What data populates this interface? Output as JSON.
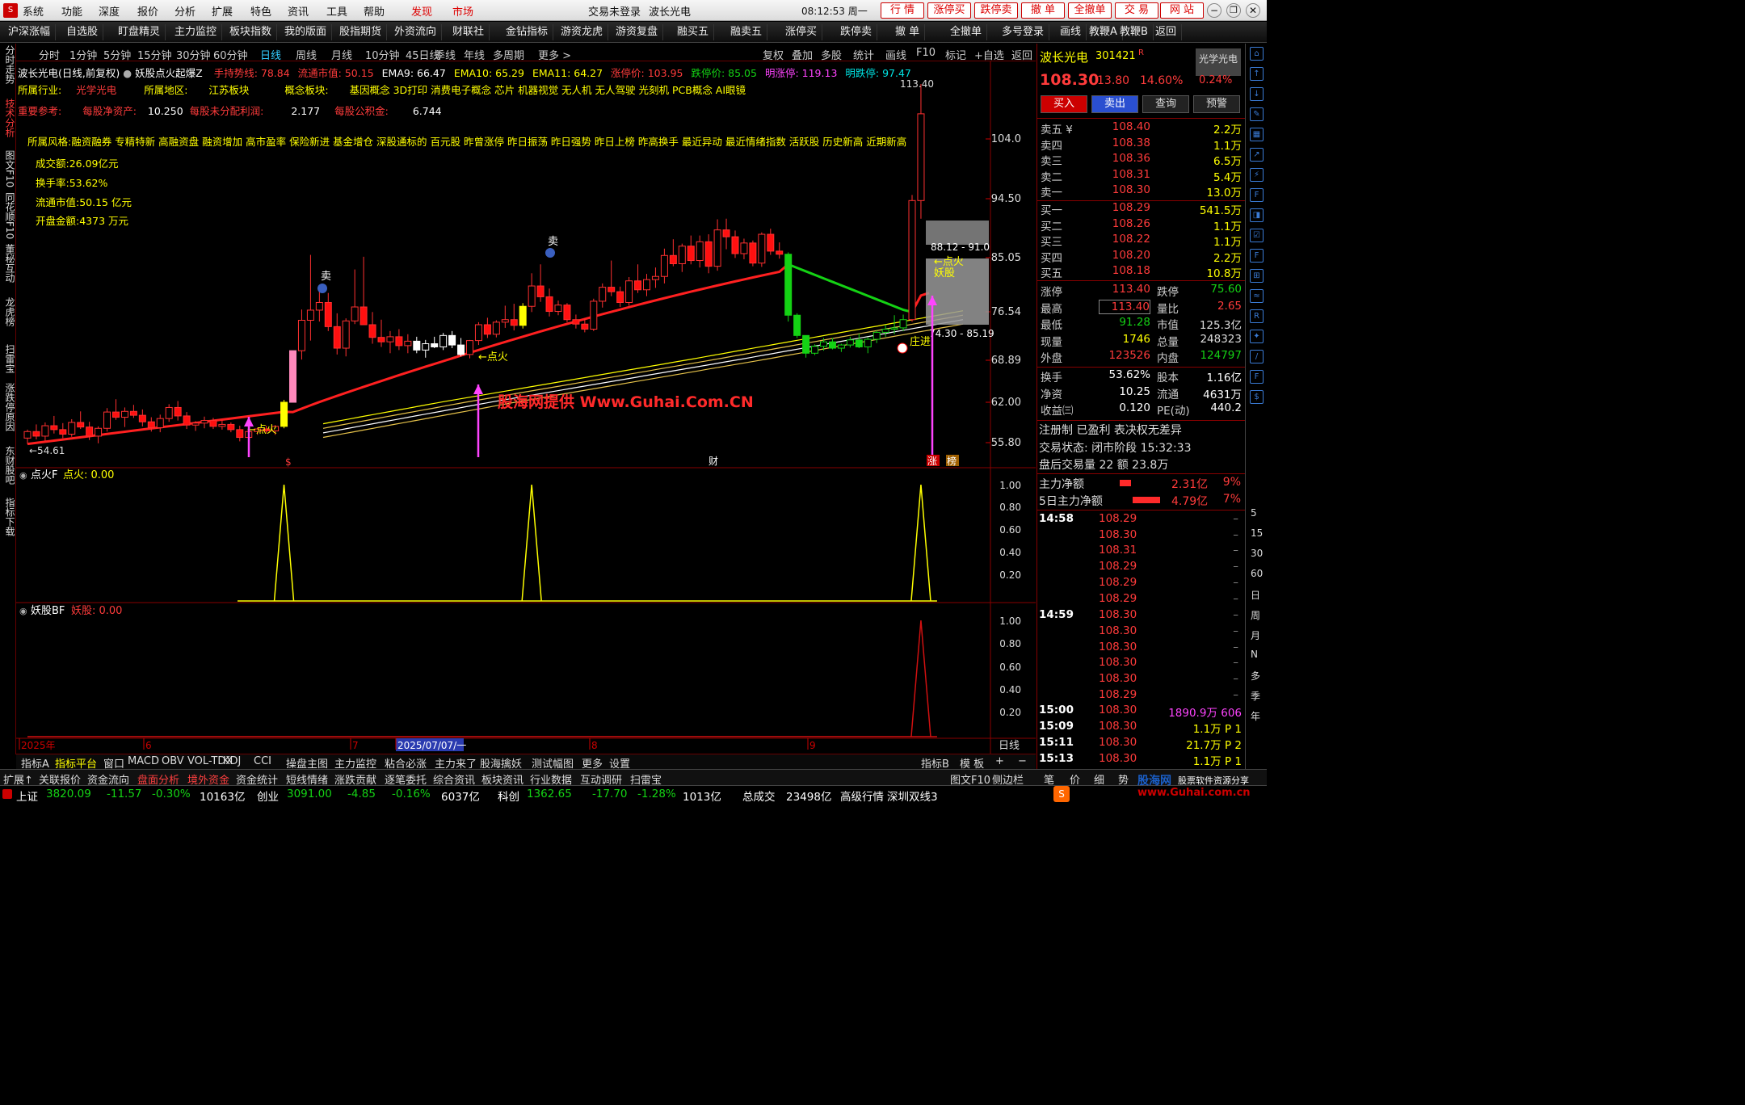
{
  "menu": {
    "items": [
      "系统",
      "功能",
      "深度",
      "报价",
      "分析",
      "扩展",
      "特色",
      "资讯",
      "工具",
      "帮助"
    ],
    "faxian": "发现",
    "shichang": "市场",
    "login_status": "交易未登录",
    "stock_name": "波长光电",
    "clock": "08:12:53 周一",
    "red_buttons": [
      "行 情",
      "涨停买",
      "跌停卖",
      "撤 单",
      "全撤单",
      "交 易",
      "网 站"
    ]
  },
  "toolbar": [
    "沪深涨幅",
    "自选股",
    "盯盘精灵",
    "主力监控",
    "板块指数",
    "我的版面",
    "股指期货",
    "外资流向",
    "财联社",
    "金钻指标",
    "游资龙虎",
    "游资复盘",
    "融买五",
    "融卖五",
    "涨停买",
    "跌停卖",
    "撤 单",
    "全撤单",
    "多号登录",
    "画线",
    "教鞭A",
    "教鞭B",
    "返回"
  ],
  "left_tabs": [
    "分时走势",
    "技术分析",
    "图文F10",
    "同花顺F10",
    "董秘互动",
    "龙虎榜",
    "扫雷宝",
    "涨跌停原因",
    "东财股吧",
    "指标下载"
  ],
  "periods": [
    "分时",
    "1分钟",
    "5分钟",
    "15分钟",
    "30分钟",
    "60分钟",
    "日线",
    "周线",
    "月线",
    "10分钟",
    "45日线",
    "季线",
    "年线",
    "多周期",
    "更多 >"
  ],
  "period_right": [
    "复权",
    "叠加",
    "多股",
    "统计",
    "画线",
    "F10",
    "标记",
    "+自选",
    "返回"
  ],
  "chart_header": {
    "title": "波长光电(日线,前复权)",
    "indicator": "妖股点火起爆Z",
    "items": [
      {
        "t": "手持势线: 78.84",
        "c": "#ff3b3b"
      },
      {
        "t": "流通市值: 50.15",
        "c": "#ff3b3b"
      },
      {
        "t": "EMA9: 66.47",
        "c": "#ffffff"
      },
      {
        "t": "EMA10: 65.29",
        "c": "#ffff00"
      },
      {
        "t": "EMA11: 64.27",
        "c": "#ffff00"
      },
      {
        "t": "涨停价: 103.95",
        "c": "#ff3b3b"
      },
      {
        "t": "跌停价: 85.05",
        "c": "#14d214"
      },
      {
        "t": "明涨停: 119.13",
        "c": "#ff44ff"
      },
      {
        "t": "明跌停: 97.47",
        "c": "#00e5e5"
      }
    ],
    "hy_label": "所属行业:",
    "hy_value": "光学光电",
    "dq_label": "所属地区:",
    "dq_value": "江苏板块",
    "gn_label": "概念板块:",
    "gn_value": "基因概念 3D打印 消费电子概念 芯片 机器视觉 无人机 无人驾驶 光刻机 PCB概念 AI眼镜",
    "zy_label": "重要参考:",
    "jzc_label": "每股净资产:",
    "jzc_value": "10.250",
    "wfp_label": "每股未分配利润:",
    "wfp_value": "2.177",
    "gjj_label": "每股公积金:",
    "gjj_value": "6.744",
    "style_line": "所属风格:融资融券 专精特新 高融资盘 融资增加 高市盈率 保险新进 基金增仓 深股通标的 百元股 昨曾涨停 昨日振荡 昨日强势 昨日上榜 昨高换手 最近异动 最近情绪指数 活跃股 历史新高 近期新高",
    "cje": "成交额:26.09亿元",
    "hsl": "换手率:53.62%",
    "ltsz": "流通市值:50.15 亿元",
    "kpje": "开盘金额:4373 万元",
    "watermark": "股海网提供 Www.Guhai.Com.CN",
    "high_label": "113.40",
    "low_label": "←54.61",
    "box_label1": "88.12 - 91.0",
    "box_label2": "74.30 - 85.19",
    "dianhuo": "←点火",
    "yaogu": "妖股",
    "zhuangjin": "庄进",
    "mai": "卖",
    "cai": "财",
    "zhang": "涨",
    "bang": "榜"
  },
  "chart_data": {
    "type": "candlestick",
    "y_ticks": [
      "104.0",
      "94.50",
      "85.05",
      "76.54",
      "68.89",
      "62.00",
      "55.80"
    ],
    "x_labels": [
      "2025年",
      "6",
      "7",
      "2025/07/07/一",
      "8",
      "9"
    ],
    "candles": [
      [
        56.5,
        57.8,
        55.6,
        57.5
      ],
      [
        57.5,
        58.6,
        56.3,
        56.8
      ],
      [
        56.8,
        58.9,
        56.1,
        58.4
      ],
      [
        58.4,
        59.9,
        57.2,
        57.8
      ],
      [
        57.8,
        58.8,
        56.5,
        57.1
      ],
      [
        57.1,
        59.4,
        56.7,
        58.9
      ],
      [
        58.9,
        60.6,
        57.9,
        58.2
      ],
      [
        58.2,
        59.0,
        56.2,
        56.8
      ],
      [
        56.8,
        58.3,
        55.7,
        58.0
      ],
      [
        58.0,
        61.1,
        57.5,
        60.5
      ],
      [
        60.5,
        62.5,
        59.3,
        59.7
      ],
      [
        59.7,
        61.2,
        58.2,
        60.6
      ],
      [
        60.6,
        61.6,
        59.6,
        60.0
      ],
      [
        60.0,
        60.9,
        58.3,
        59.0
      ],
      [
        59.0,
        59.7,
        57.5,
        58.1
      ],
      [
        58.1,
        60.1,
        57.4,
        59.5
      ],
      [
        59.5,
        61.7,
        59.0,
        61.2
      ],
      [
        61.2,
        62.2,
        59.2,
        59.9
      ],
      [
        59.9,
        60.5,
        57.9,
        58.5
      ],
      [
        58.5,
        59.1,
        57.6,
        58.8
      ],
      [
        58.8,
        59.8,
        58.0,
        59.2
      ],
      [
        59.2,
        59.6,
        57.9,
        58.3
      ],
      [
        58.3,
        59.2,
        57.8,
        58.6
      ],
      [
        58.6,
        58.9,
        57.4,
        57.8
      ],
      [
        57.8,
        58.4,
        56.0,
        56.6
      ],
      [
        56.6,
        57.9,
        56.0,
        57.5
      ],
      [
        57.5,
        58.1,
        57.0,
        57.9
      ],
      [
        57.9,
        58.4,
        57.2,
        57.6
      ],
      [
        57.6,
        58.5,
        57.0,
        58.3
      ],
      [
        58.3,
        62.4,
        58.0,
        62.0
      ],
      [
        62.0,
        70.4,
        62.0,
        70.4
      ],
      [
        70.4,
        76.9,
        69.0,
        75.2
      ],
      [
        75.2,
        85.5,
        72.0,
        76.8
      ],
      [
        76.8,
        79.8,
        75.0,
        78.0
      ],
      [
        78.0,
        79.5,
        73.5,
        74.2
      ],
      [
        74.2,
        76.3,
        69.8,
        70.8
      ],
      [
        70.8,
        75.5,
        69.5,
        75.1
      ],
      [
        75.1,
        83.2,
        74.6,
        77.3
      ],
      [
        77.3,
        85.2,
        75.8,
        74.5
      ],
      [
        74.5,
        76.5,
        71.5,
        72.5
      ],
      [
        72.5,
        75.3,
        71.0,
        71.8
      ],
      [
        71.8,
        73.5,
        70.0,
        72.6
      ],
      [
        72.6,
        73.8,
        70.5,
        71.2
      ],
      [
        71.2,
        73.0,
        70.0,
        71.9
      ],
      [
        71.9,
        72.6,
        70.0,
        70.5
      ],
      [
        70.5,
        72.1,
        69.3,
        71.5
      ],
      [
        71.5,
        72.6,
        70.8,
        71.0
      ],
      [
        71.0,
        73.2,
        70.5,
        72.8
      ],
      [
        72.8,
        73.5,
        70.8,
        71.3
      ],
      [
        71.3,
        72.4,
        69.5,
        69.8
      ],
      [
        69.8,
        72.1,
        69.2,
        72.0
      ],
      [
        72.0,
        74.9,
        71.3,
        74.5
      ],
      [
        74.5,
        75.6,
        72.4,
        73.0
      ],
      [
        73.0,
        75.2,
        72.5,
        74.9
      ],
      [
        74.9,
        77.5,
        74.0,
        75.3
      ],
      [
        75.3,
        77.8,
        73.6,
        74.4
      ],
      [
        74.4,
        77.9,
        73.9,
        77.4
      ],
      [
        77.4,
        82.6,
        76.5,
        80.6
      ],
      [
        80.6,
        84.0,
        78.1,
        78.9
      ],
      [
        78.9,
        80.2,
        75.8,
        76.6
      ],
      [
        76.6,
        78.3,
        76.0,
        77.6
      ],
      [
        77.6,
        77.9,
        74.9,
        75.3
      ],
      [
        75.3,
        76.1,
        73.9,
        74.6
      ],
      [
        74.6,
        75.5,
        73.3,
        73.8
      ],
      [
        73.8,
        78.6,
        73.5,
        78.2
      ],
      [
        78.2,
        81.0,
        77.2,
        80.4
      ],
      [
        80.4,
        84.6,
        79.0,
        79.7
      ],
      [
        79.7,
        80.5,
        77.3,
        78.0
      ],
      [
        78.0,
        82.0,
        77.5,
        81.4
      ],
      [
        81.4,
        84.0,
        79.5,
        80.0
      ],
      [
        80.0,
        82.5,
        79.0,
        81.6
      ],
      [
        81.6,
        83.5,
        80.3,
        82.1
      ],
      [
        82.1,
        86.5,
        81.0,
        85.4
      ],
      [
        85.4,
        88.0,
        83.7,
        84.1
      ],
      [
        84.1,
        87.3,
        82.8,
        86.9
      ],
      [
        86.9,
        88.6,
        84.0,
        84.6
      ],
      [
        84.6,
        88.6,
        83.5,
        87.6
      ],
      [
        87.6,
        88.8,
        82.6,
        83.7
      ],
      [
        83.7,
        91.2,
        83.0,
        89.5
      ],
      [
        89.5,
        91.3,
        86.4,
        88.4
      ],
      [
        88.4,
        89.4,
        85.0,
        85.7
      ],
      [
        85.7,
        88.1,
        84.8,
        87.4
      ],
      [
        87.4,
        87.8,
        83.7,
        84.2
      ],
      [
        84.2,
        89.1,
        83.6,
        88.8
      ],
      [
        88.8,
        89.7,
        85.5,
        86.1
      ],
      [
        86.1,
        87.5,
        84.9,
        85.6
      ],
      [
        85.6,
        85.9,
        75.0,
        76.0
      ],
      [
        76.0,
        76.3,
        72.4,
        72.8
      ],
      [
        72.8,
        72.6,
        69.3,
        70.0
      ],
      [
        70.0,
        71.4,
        69.7,
        71.1
      ],
      [
        71.1,
        72.4,
        70.4,
        71.8
      ],
      [
        71.8,
        72.4,
        70.6,
        70.8
      ],
      [
        70.8,
        71.5,
        70.2,
        71.3
      ],
      [
        71.3,
        72.6,
        70.9,
        72.1
      ],
      [
        72.1,
        73.1,
        70.8,
        71.0
      ],
      [
        71.0,
        72.5,
        70.0,
        72.2
      ],
      [
        72.2,
        73.6,
        71.6,
        73.3
      ],
      [
        73.3,
        74.5,
        72.6,
        73.8
      ],
      [
        73.8,
        76.0,
        73.0,
        74.0
      ],
      [
        74.0,
        76.1,
        73.5,
        75.3
      ],
      [
        75.3,
        95.1,
        75.0,
        94.2
      ],
      [
        94.2,
        113.4,
        91.3,
        108.3
      ]
    ],
    "signal_positions": [
      29,
      57,
      101
    ],
    "yaogu_positions": [
      101
    ]
  },
  "panel2": {
    "name": "点火F",
    "label": "点火: 0.00",
    "ticks": [
      "1.00",
      "0.80",
      "0.60",
      "0.40",
      "0.20"
    ]
  },
  "panel3": {
    "name": "妖股BF",
    "label": "妖股: 0.00",
    "ticks": [
      "1.00",
      "0.80",
      "0.60",
      "0.40",
      "0.20"
    ]
  },
  "right": {
    "name": "波长光电",
    "code": "301421",
    "tag": "R",
    "sector": "光学光电",
    "price": "108.30",
    "chg": "13.80",
    "pct": "14.60%",
    "pct2": "0.24%",
    "buttons": [
      "买入",
      "卖出",
      "查询",
      "预警"
    ],
    "sells": [
      [
        "卖五 ¥",
        "108.40",
        "2.2万"
      ],
      [
        "卖四",
        "108.38",
        "1.1万"
      ],
      [
        "卖三",
        "108.36",
        "6.5万"
      ],
      [
        "卖二",
        "108.31",
        "5.4万"
      ],
      [
        "卖一",
        "108.30",
        "13.0万"
      ]
    ],
    "buys": [
      [
        "买一",
        "108.29",
        "541.5万"
      ],
      [
        "买二",
        "108.26",
        "1.1万"
      ],
      [
        "买三",
        "108.22",
        "1.1万"
      ],
      [
        "买四",
        "108.20",
        "2.2万"
      ],
      [
        "买五",
        "108.18",
        "10.8万"
      ]
    ],
    "stats": [
      [
        "涨停",
        "113.40",
        "跌停",
        "75.60"
      ],
      [
        "最高",
        "113.40",
        "量比",
        "2.65"
      ],
      [
        "最低",
        "91.28",
        "市值",
        "125.3亿"
      ],
      [
        "现量",
        "1746",
        "总量",
        "248323"
      ],
      [
        "外盘",
        "123526",
        "内盘",
        "124797"
      ]
    ],
    "stats2": [
      [
        "换手",
        "53.62%",
        "股本",
        "1.16亿"
      ],
      [
        "净资",
        "10.25",
        "流通",
        "4631万"
      ],
      [
        "收益㈢",
        "0.120",
        "PE(动)",
        "440.2"
      ]
    ],
    "note": "注册制 已盈利 表决权无差异",
    "trade_state": "交易状态: 闭市阶段 15:32:33",
    "after": "盘后交易量 22 额 23.8万",
    "zl1": [
      "主力净额",
      "2.31亿",
      "9%"
    ],
    "zl2": [
      "5日主力净额",
      "4.79亿",
      "7%"
    ],
    "ticks": [
      [
        "14:58",
        "108.29",
        ""
      ],
      [
        "",
        "108.30",
        ""
      ],
      [
        "",
        "108.31",
        ""
      ],
      [
        "",
        "108.29",
        ""
      ],
      [
        "",
        "108.29",
        ""
      ],
      [
        "",
        "108.29",
        ""
      ],
      [
        "14:59",
        "108.30",
        ""
      ],
      [
        "",
        "108.30",
        ""
      ],
      [
        "",
        "108.30",
        ""
      ],
      [
        "",
        "108.30",
        ""
      ],
      [
        "",
        "108.30",
        ""
      ],
      [
        "",
        "108.29",
        ""
      ],
      [
        "15:00",
        "108.30",
        "1890.9万 606"
      ],
      [
        "15:09",
        "108.30",
        "1.1万 P 1"
      ],
      [
        "15:11",
        "108.30",
        "21.7万 P 2"
      ],
      [
        "15:13",
        "108.30",
        "1.1万 P 1"
      ]
    ]
  },
  "right_side": [
    "5",
    "15",
    "30",
    "60",
    "日",
    "周",
    "月",
    "N",
    "多",
    "季",
    "年"
  ],
  "bottom_tabs": [
    "指标A",
    "指标平台",
    "窗口",
    "MACD",
    "OBV",
    "VOL-TDX",
    "KDJ",
    "CCI",
    "操盘主图",
    "主力监控",
    "粘合必涨",
    "主力来了",
    "股海擒妖",
    "测试幅图",
    "更多",
    "设置"
  ],
  "bottom_tabs_right": [
    "指标B",
    "模 板",
    "+",
    "−"
  ],
  "bottom_tabs2": [
    "扩展↑",
    "关联报价",
    "资金流向",
    "盘面分析",
    "境外资金",
    "资金统计",
    "短线情绪",
    "涨跌贡献",
    "逐笔委托",
    "综合资讯",
    "板块资讯",
    "行业数据",
    "互动调研",
    "扫雷宝"
  ],
  "bottom_tabs2_right": [
    "图文F10",
    "侧边栏",
    "笔",
    "价",
    "细",
    "势"
  ],
  "status": {
    "sh": "上证",
    "sh_v": "3820.09",
    "sh_c": "-11.57",
    "sh_p": "-0.30%",
    "sh_a": "10163亿",
    "cy": "创业",
    "cy_v": "3091.00",
    "cy_c": "-4.85",
    "cy_p": "-0.16%",
    "cy_a": "6037亿",
    "kc": "科创",
    "kc_v": "1362.65",
    "kc_c": "-17.70",
    "kc_p": "-1.28%",
    "kc_a": "1013亿",
    "zcj": "总成交",
    "zcj_v": "23498亿",
    "hq": "高级行情",
    "line": "深圳双线3",
    "brand": "股海网",
    "brand2": "股票软件资源分享",
    "brand3": "www.Guhai.com.cn"
  },
  "rb_label": "日线",
  "colors": {
    "up": "#ff3b3b",
    "down": "#14d214",
    "accent": "#ff44ff",
    "yellow": "#ffff00"
  }
}
